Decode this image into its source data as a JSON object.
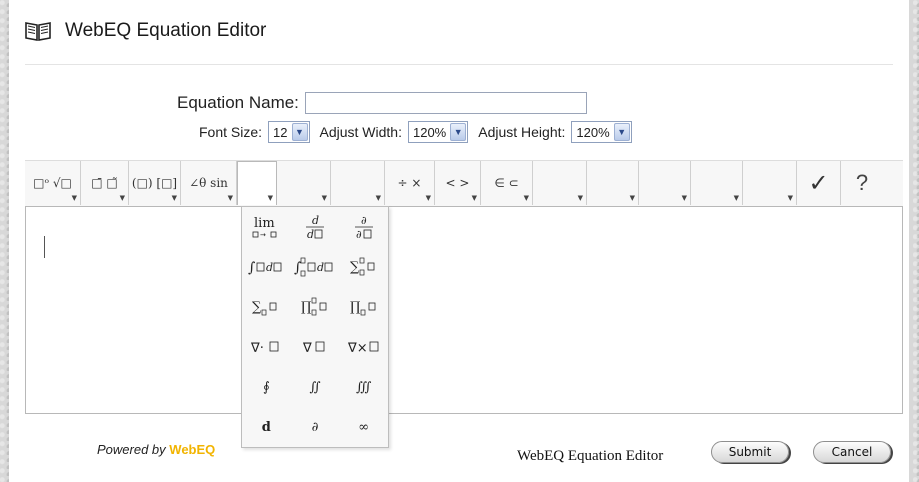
{
  "app": {
    "title": "WebEQ Equation Editor"
  },
  "form": {
    "equation_name_label": "Equation Name:",
    "equation_name_value": "",
    "font_size_label": "Font Size:",
    "font_size_value": "12",
    "adjust_width_label": "Adjust Width:",
    "adjust_width_value": "120%",
    "adjust_height_label": "Adjust Height:",
    "adjust_height_value": "120%"
  },
  "toolbar": {
    "buttons": [
      {
        "name": "scripts-radicals",
        "glyph": "□ᵒ √□"
      },
      {
        "name": "accents",
        "glyph": "□̄ □̃"
      },
      {
        "name": "fences",
        "glyph": "(□) [□]"
      },
      {
        "name": "geometry-trig",
        "glyph": "∠θ sin"
      },
      {
        "name": "calculus",
        "glyph": ""
      },
      {
        "name": "blank-1",
        "glyph": ""
      },
      {
        "name": "blank-2",
        "glyph": ""
      },
      {
        "name": "operators",
        "glyph": "÷ ×"
      },
      {
        "name": "relations",
        "glyph": "< >"
      },
      {
        "name": "sets",
        "glyph": "∈ ⊂"
      },
      {
        "name": "blank-3",
        "glyph": ""
      },
      {
        "name": "blank-4",
        "glyph": ""
      },
      {
        "name": "blank-5",
        "glyph": ""
      },
      {
        "name": "blank-6",
        "glyph": ""
      },
      {
        "name": "blank-7",
        "glyph": ""
      }
    ],
    "check_glyph": "✓",
    "help_glyph": "?"
  },
  "calculus_palette": [
    "lim□→□",
    "d/d□",
    "∂/∂□",
    "∫□d□",
    "∫□□ □d□",
    "∑□□ □",
    "∑□ □",
    "∏□□ □",
    "∏□ □",
    "∇·□",
    "∇□",
    "∇×□",
    "∮",
    "∬",
    "∭",
    "d",
    "∂",
    "∞"
  ],
  "footer": {
    "powered_by": "Powered by",
    "brand": "WebEQ",
    "title": "WebEQ Equation Editor",
    "submit": "Submit",
    "cancel": "Cancel"
  }
}
